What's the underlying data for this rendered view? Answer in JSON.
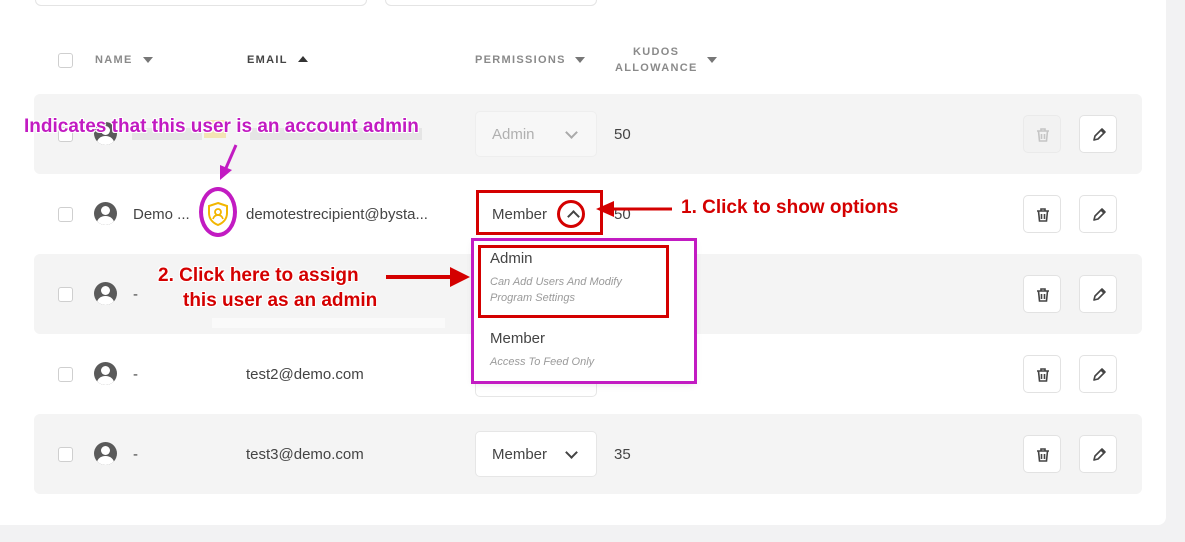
{
  "header": {
    "name": "NAME",
    "email": "EMAIL",
    "permissions": "PERMISSIONS",
    "kudos_line1": "KUDOS",
    "kudos_line2": "ALLOWANCE"
  },
  "rows": [
    {
      "name": "",
      "email": "",
      "permission": "Admin",
      "kudos": "50"
    },
    {
      "name": "Demo ...",
      "email": "demotestrecipient@bysta...",
      "permission": "Member",
      "kudos": "50"
    },
    {
      "name": "-",
      "email": "",
      "permission": "",
      "kudos": ""
    },
    {
      "name": "-",
      "email": "test2@demo.com",
      "permission": "",
      "kudos": ""
    },
    {
      "name": "-",
      "email": "test3@demo.com",
      "permission": "Member",
      "kudos": "35"
    }
  ],
  "dropdown": {
    "options": [
      {
        "title": "Admin",
        "description": "Can Add Users And Modify Program Settings"
      },
      {
        "title": "Member",
        "description": "Access To Feed Only"
      }
    ]
  },
  "annotations": {
    "admin_indicator": "Indicates that this user is an account admin",
    "step1": "1. Click to show options",
    "step2_line1": "2. Click here to assign",
    "step2_line2": "this user as an admin"
  },
  "colors": {
    "annotation_red": "#d40000",
    "annotation_magenta": "#c21bc2",
    "admin_badge": "#f2b600"
  },
  "icons": {
    "sort_desc": "triangle-down-icon",
    "sort_asc": "triangle-up-icon",
    "delete": "trash-icon",
    "edit": "pencil-icon",
    "avatar": "user-avatar-icon",
    "admin": "shield-user-icon"
  }
}
